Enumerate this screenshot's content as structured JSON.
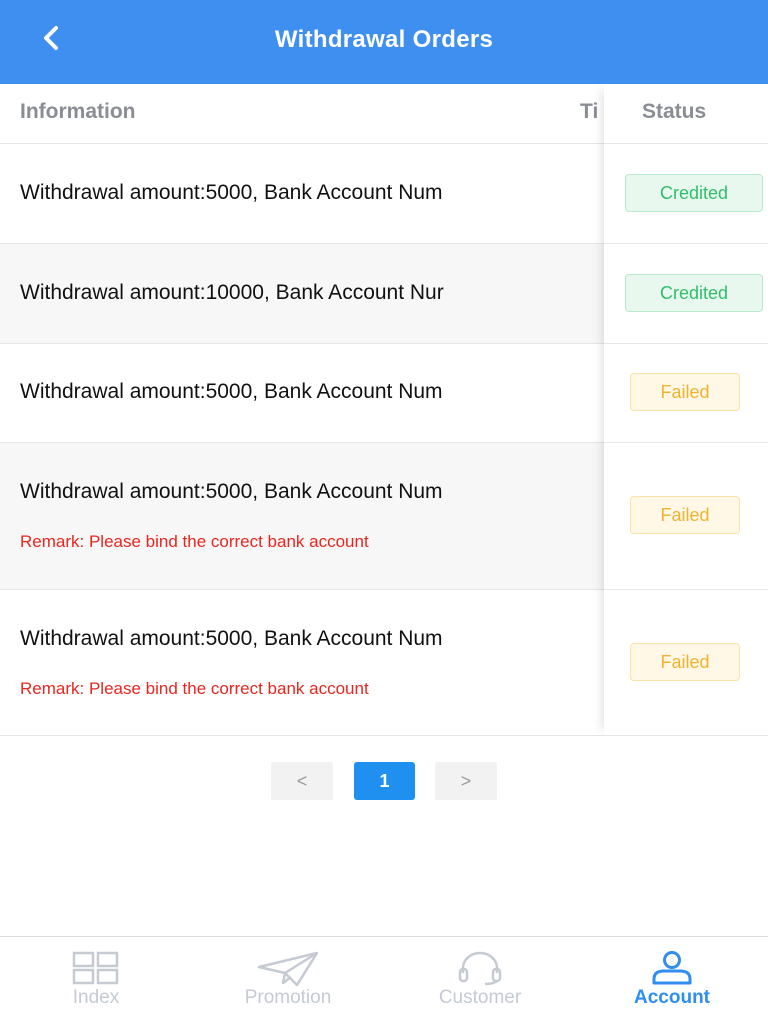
{
  "header": {
    "title": "Withdrawal Orders"
  },
  "table": {
    "columns": {
      "information": "Information",
      "time": "Ti",
      "status": "Status"
    },
    "rows": [
      {
        "information": "Withdrawal amount:5000, Bank Account Num",
        "remark": "",
        "status": "Credited",
        "status_type": "success"
      },
      {
        "information": "Withdrawal amount:10000, Bank Account Nur",
        "remark": "",
        "status": "Credited",
        "status_type": "success"
      },
      {
        "information": "Withdrawal amount:5000, Bank Account Num",
        "remark": "",
        "status": "Failed",
        "status_type": "warning"
      },
      {
        "information": "Withdrawal amount:5000, Bank Account Num",
        "remark": "Remark: Please bind the correct bank account",
        "status": "Failed",
        "status_type": "warning"
      },
      {
        "information": "Withdrawal amount:5000, Bank Account Num",
        "remark": "Remark: Please bind the correct bank account",
        "status": "Failed",
        "status_type": "warning"
      }
    ]
  },
  "pagination": {
    "prev": "<",
    "current": "1",
    "next": ">"
  },
  "tabbar": {
    "items": [
      {
        "label": "Index",
        "icon": "grid-icon",
        "active": false
      },
      {
        "label": "Promotion",
        "icon": "paper-plane-icon",
        "active": false
      },
      {
        "label": "Customer",
        "icon": "headset-icon",
        "active": false
      },
      {
        "label": "Account",
        "icon": "user-icon",
        "active": true
      }
    ]
  },
  "colors": {
    "header_bg": "#3f8ff1",
    "active_tab": "#2f8ef0",
    "credited": "#2fbf6a",
    "failed": "#f2b230",
    "remark": "#e8261f",
    "page_active": "#1f8ff0"
  }
}
